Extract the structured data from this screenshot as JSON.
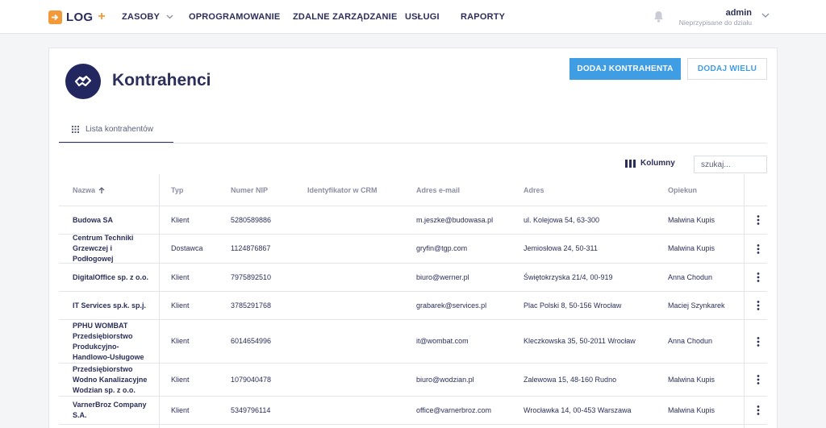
{
  "brand": {
    "logo_text": "LOG",
    "logo_plus": "+"
  },
  "nav": [
    {
      "label": "ZASOBY",
      "has_caret": true
    },
    {
      "label": "OPROGRAMOWANIE"
    },
    {
      "label": "ZDALNE ZARZĄDZANIE"
    },
    {
      "label": "USŁUGI"
    },
    {
      "label": "RAPORTY"
    }
  ],
  "user": {
    "name": "admin",
    "department": "Nieprzypisane do działu"
  },
  "page": {
    "title": "Kontrahenci",
    "add_button": "DODAJ KONTRAHENTA",
    "add_many_button": "DODAJ WIELU",
    "tab_label": "Lista kontrahentów",
    "columns_button": "Kolumny",
    "search_placeholder": "szukaj..."
  },
  "table": {
    "headers": {
      "name": "Nazwa",
      "type": "Typ",
      "nip": "Numer NIP",
      "crm": "Identyfikator w CRM",
      "email": "Adres e-mail",
      "address": "Adres",
      "guardian": "Opiekun"
    },
    "sort_column": "name",
    "sort_direction": "ascending",
    "rows": [
      {
        "name": "Budowa SA",
        "type": "Klient",
        "nip": "5280589886",
        "crm": "",
        "email": "m.jeszke@budowasa.pl",
        "address": "ul. Kolejowa 54, 63-300",
        "guardian": "Malwina Kupis"
      },
      {
        "name": "Centrum Techniki Grzewczej i Podłogowej",
        "type": "Dostawca",
        "nip": "1124876867",
        "crm": "",
        "email": "gryfin@tgp.com",
        "address": "Jemiosłowa 24, 50-311",
        "guardian": "Malwina Kupis"
      },
      {
        "name": "DigitalOffice sp. z o.o.",
        "type": "Klient",
        "nip": "7975892510",
        "crm": "",
        "email": "biuro@werner.pl",
        "address": "Świętokrzyska 21/4, 00-919",
        "guardian": "Anna Chodun"
      },
      {
        "name": "IT Services sp.k. sp.j.",
        "type": "Klient",
        "nip": "3785291768",
        "crm": "",
        "email": "grabarek@services.pl",
        "address": "Plac Polski 8, 50-156 Wrocław",
        "guardian": "Maciej Szynkarek"
      },
      {
        "name": "PPHU WOMBAT Przedsiębiorstwo Produkcyjno-Handlowo-Usługowe",
        "type": "Klient",
        "nip": "6014654996",
        "crm": "",
        "email": "it@wombat.com",
        "address": "Kleczkowska 35, 50-2011 Wrocław",
        "guardian": "Anna Chodun"
      },
      {
        "name": "Przedsiębiorstwo Wodno Kanalizacyjne Wodzian sp. z o.o.",
        "type": "Klient",
        "nip": "1079040478",
        "crm": "",
        "email": "biuro@wodzian.pl",
        "address": "Zalewowa 15, 48-160 Rudno",
        "guardian": "Malwina Kupis"
      },
      {
        "name": "VarnerBroz Company S.A.",
        "type": "Klient",
        "nip": "5349796114",
        "crm": "",
        "email": "office@varnerbroz.com",
        "address": "Wrocławka 14, 00-453 Warszawa",
        "guardian": "Malwina Kupis"
      }
    ]
  },
  "colors": {
    "accent": "#3f9de4",
    "brand_orange": "#f29a3a",
    "navy": "#2b2f5a"
  }
}
